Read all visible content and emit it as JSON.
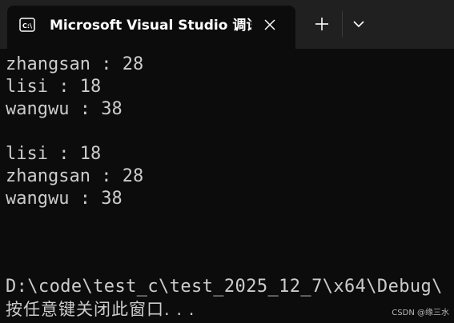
{
  "tab": {
    "title": "Microsoft Visual Studio 调试控制台",
    "icon": "terminal-icon",
    "close_icon": "close-icon"
  },
  "titlebar": {
    "new_tab_icon": "plus-icon",
    "dropdown_icon": "chevron-down-icon"
  },
  "console": {
    "lines": [
      "zhangsan : 28",
      "lisi : 18",
      "wangwu : 38",
      "",
      "lisi : 18",
      "zhangsan : 28",
      "wangwu : 38"
    ],
    "exit_path": "D:\\code\\test_c\\test_2025_12_7\\x64\\Debug\\",
    "prompt": "按任意键关闭此窗口. . ."
  },
  "watermark": "CSDN @缘三水",
  "colors": {
    "background": "#0c0c0c",
    "titlebar": "#202020",
    "text": "#cccccc",
    "title_text": "#ffffff"
  }
}
